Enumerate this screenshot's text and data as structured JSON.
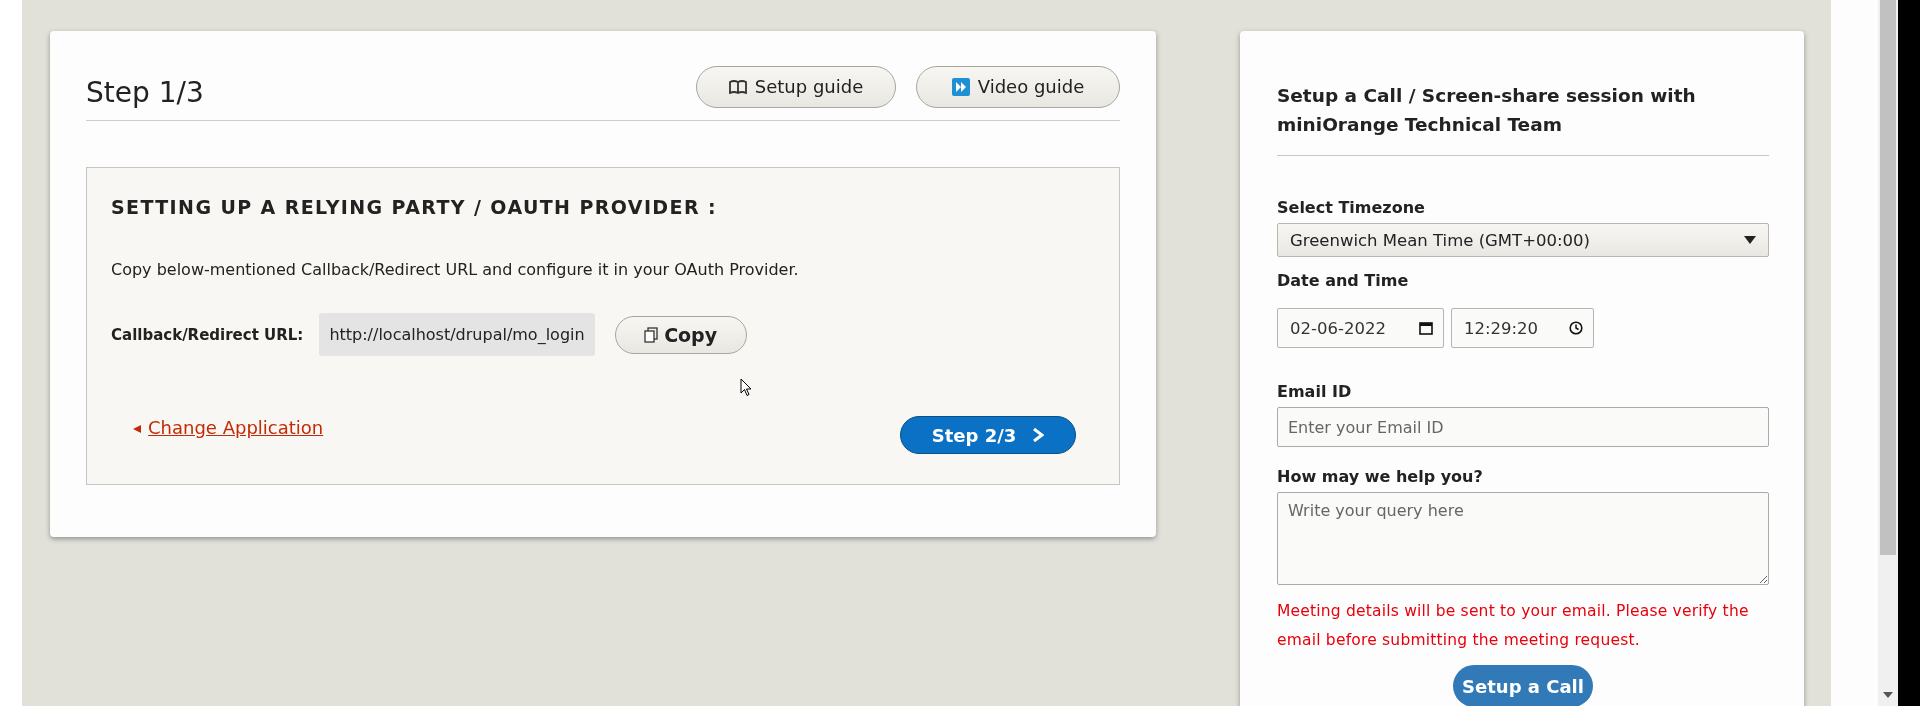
{
  "main_card": {
    "title": "Step 1/3",
    "buttons": [
      {
        "kind": "book",
        "label": "Setup guide"
      },
      {
        "kind": "play",
        "label": "Video guide"
      }
    ],
    "section": {
      "heading": "SETTING UP A RELYING PARTY / OAUTH PROVIDER :",
      "description": "Copy below-mentioned Callback/Redirect URL and configure it in your OAuth Provider.",
      "url_label": "Callback/Redirect URL:",
      "url_value": "http://localhost/drupal/mo_login",
      "copy_button": "Copy",
      "back_link": "Change Application",
      "next_button": "Step 2/3"
    }
  },
  "call_card": {
    "title": "Setup a Call / Screen-share session with miniOrange Technical Team",
    "timezone_label": "Select Timezone",
    "timezone_value": "Greenwich Mean Time (GMT+00:00)",
    "datetime_label": "Date and Time",
    "date_value": "02-06-2022",
    "time_value": "12:29:20",
    "email_label": "Email ID",
    "email_placeholder": "Enter your Email ID",
    "query_label": "How may we help you?",
    "query_placeholder": "Write your query here",
    "notice": "Meeting details will be sent to your email. Please verify the email before submitting the meeting request.",
    "submit_button": "Setup a Call"
  }
}
